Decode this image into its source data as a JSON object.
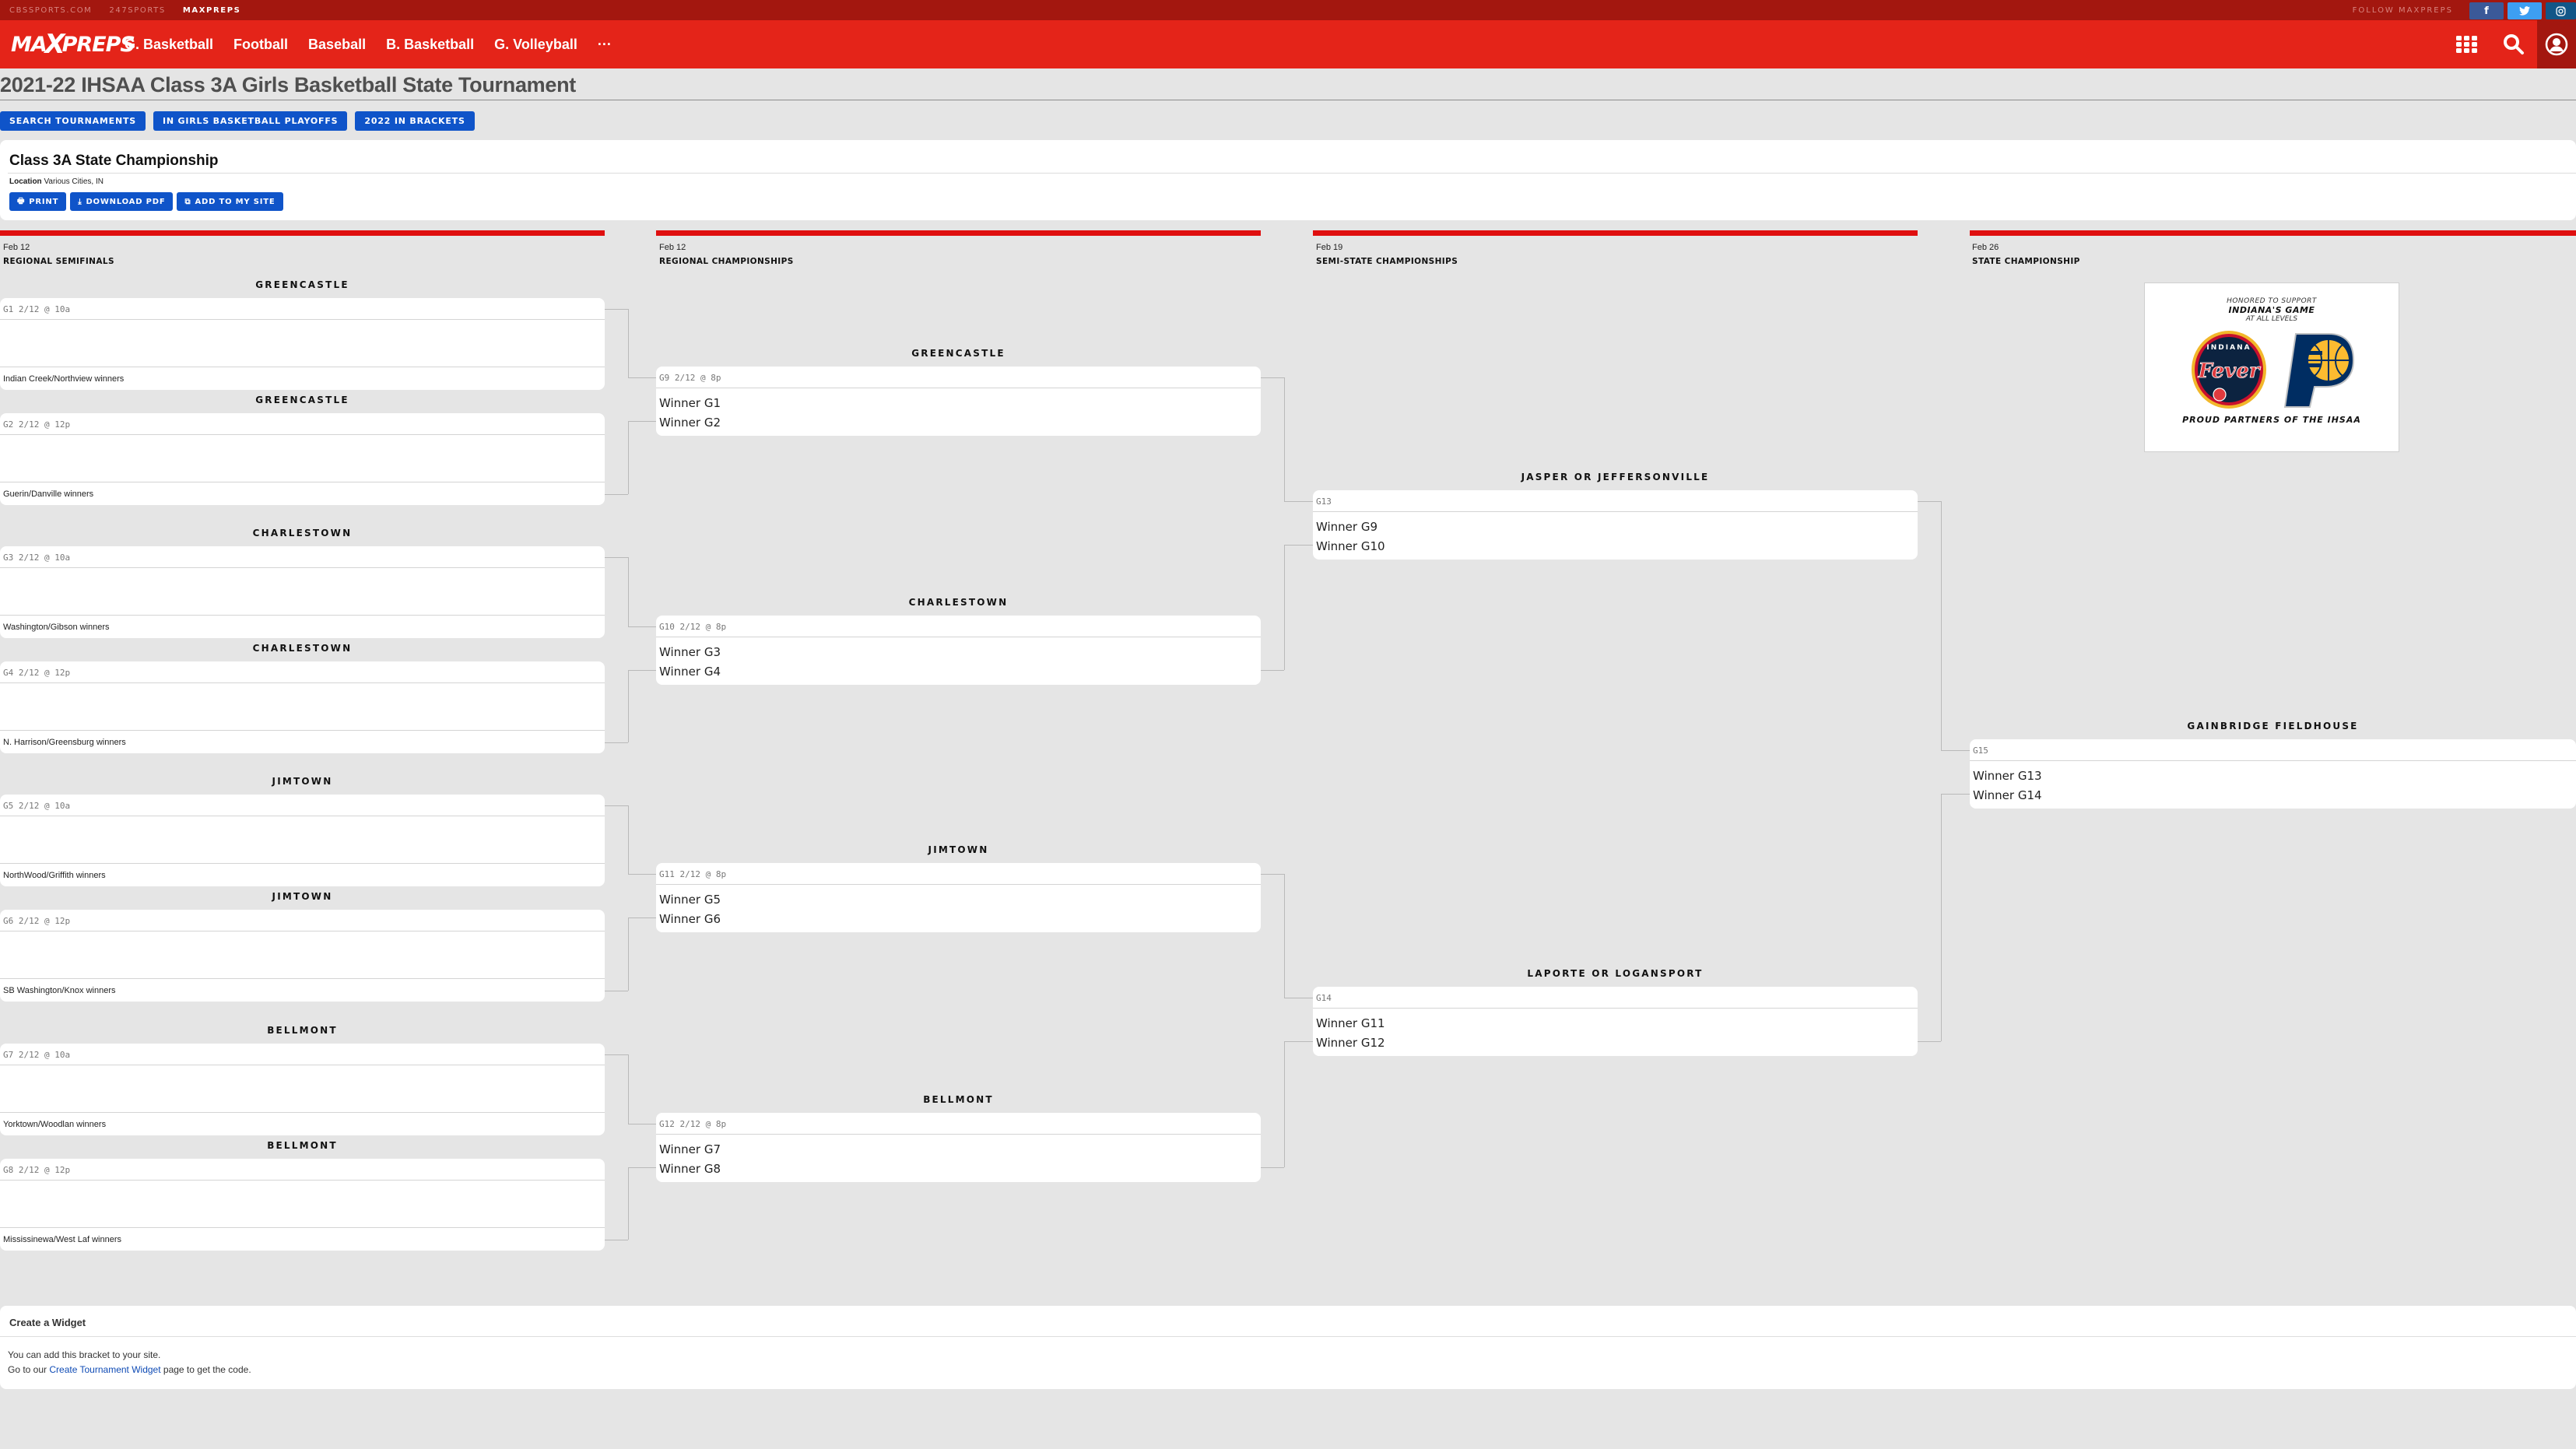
{
  "topbar": {
    "links": [
      "CBSSPORTS.COM",
      "247SPORTS",
      "MAXPREPS"
    ],
    "active_link": "MAXPREPS",
    "follow_label": "FOLLOW MAXPREPS",
    "social": [
      {
        "name": "facebook",
        "glyph": "f",
        "color": "#3b5998"
      },
      {
        "name": "twitter",
        "glyph": "🐦",
        "color": "#3d9ff2"
      },
      {
        "name": "instagram",
        "glyph": "◎",
        "color": "#125688"
      }
    ]
  },
  "nav": {
    "logo": "MAXPREPS",
    "items": [
      "G. Basketball",
      "Football",
      "Baseball",
      "B. Basketball",
      "G. Volleyball",
      "···"
    ],
    "icons": [
      "apps-grid-icon",
      "search-icon",
      "user-account-icon"
    ]
  },
  "page": {
    "title": "2021-22 IHSAA Class 3A Girls Basketball State Tournament",
    "buttons": [
      "SEARCH TOURNAMENTS",
      "IN GIRLS BASKETBALL PLAYOFFS",
      "2022 IN BRACKETS"
    ]
  },
  "info": {
    "title": "Class 3A State Championship",
    "location_label": "Location",
    "location_value": "Various Cities, IN",
    "actions": [
      {
        "label": "PRINT",
        "icon": "🖶"
      },
      {
        "label": "DOWNLOAD PDF",
        "icon": "⤓"
      },
      {
        "label": "ADD TO MY SITE",
        "icon": "⧉"
      }
    ]
  },
  "rounds": [
    {
      "date": "Feb 12",
      "name": "REGIONAL SEMIFINALS"
    },
    {
      "date": "Feb 12",
      "name": "REGIONAL CHAMPIONSHIPS"
    },
    {
      "date": "Feb 19",
      "name": "SEMI-STATE CHAMPIONSHIPS"
    },
    {
      "date": "Feb 26",
      "name": "STATE CHAMPIONSHIP"
    }
  ],
  "accent_color": "#df0f0f",
  "button_color": "#0f54c9",
  "matches": {
    "round1": [
      {
        "site": "GREENCASTLE",
        "header": "G1 2/12 @ 10a",
        "team": "Indian Creek/Northview winners"
      },
      {
        "site": "GREENCASTLE",
        "header": "G2 2/12 @ 12p",
        "team": "Guerin/Danville winners"
      },
      {
        "site": "CHARLESTOWN",
        "header": "G3 2/12 @ 10a",
        "team": "Washington/Gibson winners"
      },
      {
        "site": "CHARLESTOWN",
        "header": "G4 2/12 @ 12p",
        "team": "N. Harrison/Greensburg winners"
      },
      {
        "site": "JIMTOWN",
        "header": "G5 2/12 @ 10a",
        "team": "NorthWood/Griffith winners"
      },
      {
        "site": "JIMTOWN",
        "header": "G6 2/12 @ 12p",
        "team": "SB Washington/Knox winners"
      },
      {
        "site": "BELLMONT",
        "header": "G7 2/12 @ 10a",
        "team": "Yorktown/Woodlan winners"
      },
      {
        "site": "BELLMONT",
        "header": "G8 2/12 @ 12p",
        "team": "Mississinewa/West Laf winners"
      }
    ],
    "round2": [
      {
        "site": "GREENCASTLE",
        "header": "G9 2/12 @ 8p",
        "teams": [
          "Winner G1",
          "Winner G2"
        ]
      },
      {
        "site": "CHARLESTOWN",
        "header": "G10 2/12 @ 8p",
        "teams": [
          "Winner G3",
          "Winner G4"
        ]
      },
      {
        "site": "JIMTOWN",
        "header": "G11 2/12 @ 8p",
        "teams": [
          "Winner G5",
          "Winner G6"
        ]
      },
      {
        "site": "BELLMONT",
        "header": "G12 2/12 @ 8p",
        "teams": [
          "Winner G7",
          "Winner G8"
        ]
      }
    ],
    "round3": [
      {
        "site": "JASPER OR JEFFERSONVILLE",
        "header": "G13",
        "teams": [
          "Winner G9",
          "Winner G10"
        ]
      },
      {
        "site": "LAPORTE OR LOGANSPORT",
        "header": "G14",
        "teams": [
          "Winner G11",
          "Winner G12"
        ]
      }
    ],
    "round4": [
      {
        "site": "GAINBRIDGE FIELDHOUSE",
        "header": "G15",
        "teams": [
          "Winner G13",
          "Winner G14"
        ]
      }
    ]
  },
  "sponsor": {
    "line1": "HONORED TO SUPPORT",
    "line2": "INDIANA'S GAME",
    "line3": "AT ALL LEVELS",
    "logo_left": "Fever",
    "logo_left_ring": "INDIANA",
    "logo_right": "P",
    "line4": "PROUD PARTNERS OF THE IHSAA"
  },
  "widget": {
    "title": "Create a Widget",
    "line1": "You can add this bracket to your site.",
    "line2_pre": "Go to our ",
    "line2_link": "Create Tournament Widget",
    "line2_post": " page to get the code."
  }
}
